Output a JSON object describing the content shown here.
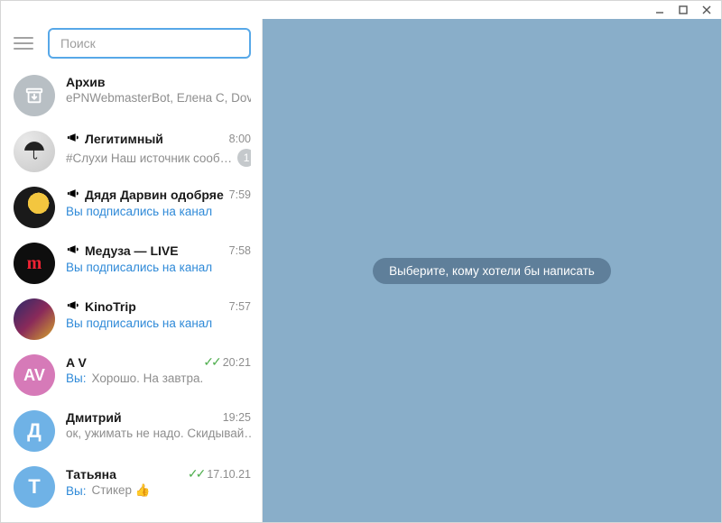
{
  "search": {
    "placeholder": "Поиск",
    "value": ""
  },
  "right_panel": {
    "empty_msg": "Выберите, кому хотели бы написать"
  },
  "archive": {
    "label": "Архив",
    "preview": "ePNWebmasterBot, Елена С, Dov…"
  },
  "chats": [
    {
      "has_megaphone": true,
      "title": "Легитимный",
      "time": "8:00",
      "preview_prefix": "",
      "preview": "#Слухи  Наш источник сооб…",
      "preview_link": false,
      "checks": false,
      "unread": "1",
      "avatar_class": "legit",
      "avatar_text": "",
      "avatar_svg": "umbrella"
    },
    {
      "has_megaphone": true,
      "title": "Дядя Дарвин одобряе…",
      "time": "7:59",
      "preview_prefix": "",
      "preview": "Вы подписались на канал",
      "preview_link": true,
      "checks": false,
      "unread": "",
      "avatar_class": "darwin",
      "avatar_text": ""
    },
    {
      "has_megaphone": true,
      "title": "Медуза — LIVE",
      "time": "7:58",
      "preview_prefix": "",
      "preview": "Вы подписались на канал",
      "preview_link": true,
      "checks": false,
      "unread": "",
      "avatar_class": "meduza",
      "avatar_text": "m"
    },
    {
      "has_megaphone": true,
      "title": "KinoTrip",
      "time": "7:57",
      "preview_prefix": "",
      "preview": "Вы подписались на канал",
      "preview_link": true,
      "checks": false,
      "unread": "",
      "avatar_class": "kinotrip",
      "avatar_text": ""
    },
    {
      "has_megaphone": false,
      "title": "A V",
      "time": "20:21",
      "preview_prefix": "Вы: ",
      "preview": "Хорошо. На завтра.",
      "preview_link": false,
      "checks": true,
      "unread": "",
      "avatar_class": "av",
      "avatar_text": "AV"
    },
    {
      "has_megaphone": false,
      "title": "Дмитрий",
      "time": "19:25",
      "preview_prefix": "",
      "preview": "ок, ужимать не надо. Скидывай…",
      "preview_link": false,
      "checks": false,
      "unread": "",
      "avatar_class": "dm",
      "avatar_text": "Д"
    },
    {
      "has_megaphone": false,
      "title": "Татьяна",
      "time": "17.10.21",
      "preview_prefix": "Вы: ",
      "preview": "Стикер 👍",
      "preview_link": false,
      "checks": true,
      "unread": "",
      "avatar_class": "ta",
      "avatar_text": "Т"
    }
  ]
}
